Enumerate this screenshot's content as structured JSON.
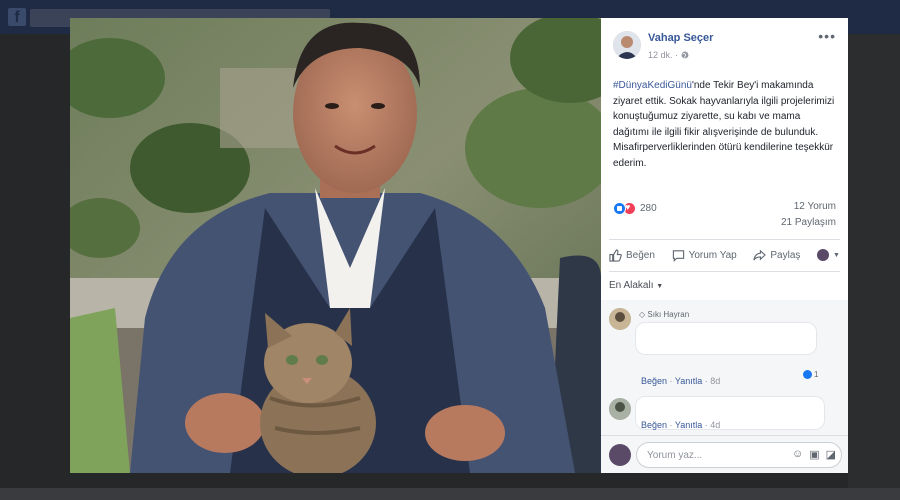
{
  "post": {
    "author": "Vahap Seçer",
    "time": "12 dk.",
    "privacy_icon": "globe-icon",
    "hashtag": "#DünyaKediGünü",
    "text": "'nde Tekir Bey'i makamında ziyaret ettik. Sokak hayvanlarıyla ilgili projelerimizi konuştuğumuz ziyarette, su kabı ve mama dağıtımı ile ilgili fikir alışverişinde de bulunduk. Misafirperverliklerinden ötürü kendilerine teşekkür ederim."
  },
  "stats": {
    "reactions_count": "280",
    "comments": "12 Yorum",
    "shares": "21 Paylaşım"
  },
  "actions": {
    "like": "Beğen",
    "comment": "Yorum Yap",
    "share": "Paylaş"
  },
  "sort": {
    "label": "En Alakalı"
  },
  "comments": [
    {
      "badge": "Sıkı Hayran",
      "like": "Beğen",
      "reply": "Yanıtla",
      "time": "8d",
      "reaction_count": "1"
    },
    {
      "like": "Beğen",
      "reply": "Yanıtla",
      "time": "4d"
    }
  ],
  "composer": {
    "placeholder": "Yorum yaz..."
  },
  "colors": {
    "link": "#385898",
    "like_blue": "#1877f2",
    "love_red": "#f33e58"
  }
}
